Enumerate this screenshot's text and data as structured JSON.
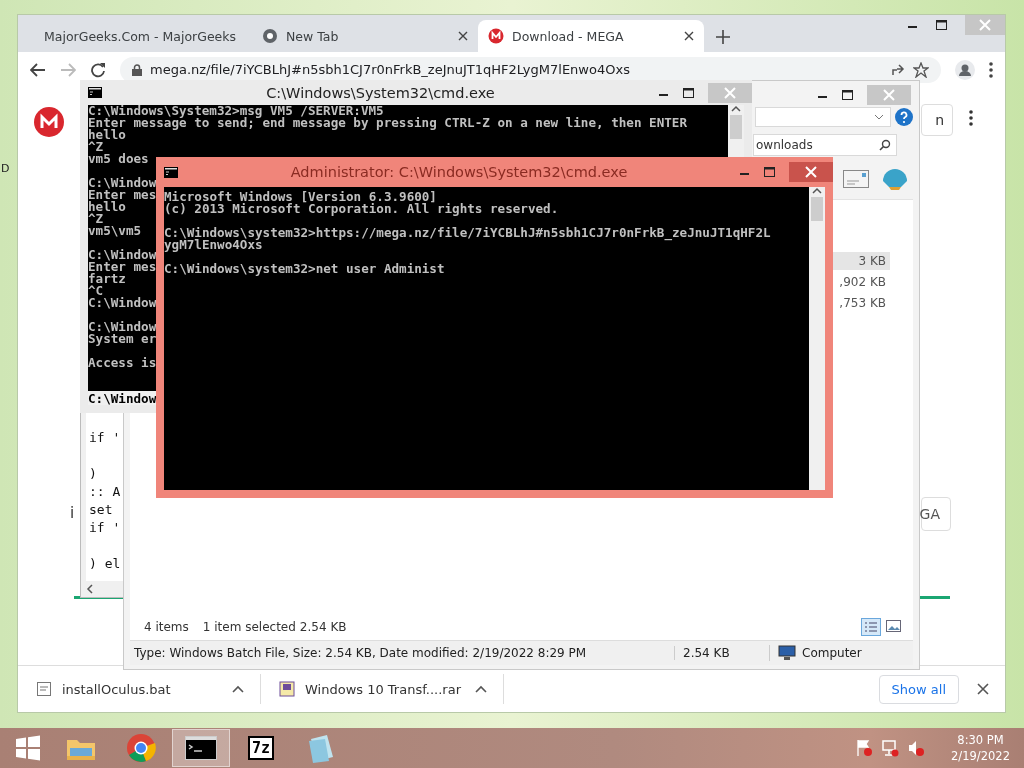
{
  "desktop": {
    "edge_label": "D"
  },
  "browser": {
    "tabs": [
      {
        "title": "MajorGeeks.Com - MajorGeeks",
        "selected": false
      },
      {
        "title": "New Tab",
        "selected": false
      },
      {
        "title": "Download - MEGA",
        "selected": true
      }
    ],
    "url": "mega.nz/file/7iYCBLhJ#n5sbh1CJ7r0nFrkB_zeJnuJT1qHF2LygM7lEnwo4Oxs",
    "page": {
      "top_button": "n",
      "side_letter": "i",
      "bottom_button": "GA",
      "progress": {
        "level": 1
      }
    },
    "downloads": [
      {
        "name": "installOculus.bat",
        "kind": "bat"
      },
      {
        "name": "Windows 10 Transf....rar",
        "kind": "rar"
      }
    ],
    "show_all": "Show all"
  },
  "notepad": {
    "lines": [
      {
        "kind": "text",
        "text": "if '"
      },
      {
        "kind": "blank"
      },
      {
        "kind": "text",
        "text": ")"
      },
      {
        "kind": "text",
        "text": ":: A"
      },
      {
        "kind": "text",
        "text": "set"
      },
      {
        "kind": "text",
        "text": "if '"
      },
      {
        "kind": "blank"
      },
      {
        "kind": "text",
        "text": ") el"
      }
    ]
  },
  "explorer": {
    "search": {
      "value": "ownloads"
    },
    "files": [
      {
        "size": "3 KB",
        "selected": true
      },
      {
        "size": ",902 KB",
        "selected": false
      },
      {
        "size": ",753 KB",
        "selected": false
      }
    ],
    "status": {
      "items": "4 items",
      "selection": "1 item selected",
      "selection_size": "2.54 KB"
    },
    "details": {
      "summary": "Type: Windows Batch File, Size: 2.54 KB, Date modified: 2/19/2022 8:29 PM",
      "size": "2.54 KB",
      "zone": "Computer"
    }
  },
  "cmd_window": {
    "title": "C:\\Windows\\System32\\cmd.exe",
    "active": false,
    "lines": [
      {
        "kind": "text",
        "text": "C:\\Windows\\System32>msg VM5 /SERVER:VM5",
        "selected": false
      },
      {
        "kind": "text",
        "text": "Enter message to send; end message by pressing CTRL-Z on a new line, then ENTER",
        "selected": false
      },
      {
        "kind": "text",
        "text": "hello",
        "selected": false
      },
      {
        "kind": "text",
        "text": "^Z",
        "selected": false
      },
      {
        "kind": "text",
        "text": "vm5 does",
        "selected": false
      },
      {
        "kind": "blank"
      },
      {
        "kind": "text",
        "text": "C:\\Window",
        "selected": false
      },
      {
        "kind": "text",
        "text": "Enter mes",
        "selected": false
      },
      {
        "kind": "text",
        "text": "hello",
        "selected": false
      },
      {
        "kind": "text",
        "text": "^Z",
        "selected": false
      },
      {
        "kind": "text",
        "text": "vm5\\vm5",
        "selected": false
      },
      {
        "kind": "blank"
      },
      {
        "kind": "text",
        "text": "C:\\Window",
        "selected": false
      },
      {
        "kind": "text",
        "text": "Enter mes",
        "selected": false
      },
      {
        "kind": "text",
        "text": "fartz",
        "selected": false
      },
      {
        "kind": "text",
        "text": "^C",
        "selected": false
      },
      {
        "kind": "text",
        "text": "C:\\Window",
        "selected": false
      },
      {
        "kind": "blank"
      },
      {
        "kind": "text",
        "text": "C:\\Window",
        "selected": false
      },
      {
        "kind": "text",
        "text": "System er",
        "selected": false
      },
      {
        "kind": "blank"
      },
      {
        "kind": "text",
        "text": "Access is",
        "selected": false
      },
      {
        "kind": "blank"
      },
      {
        "kind": "blank"
      },
      {
        "kind": "text",
        "text": "C:\\Window",
        "selected": true
      }
    ]
  },
  "admin_window": {
    "title": "Administrator: C:\\Windows\\System32\\cmd.exe",
    "active": true,
    "lines": [
      {
        "kind": "text",
        "text": "Microsoft Windows [Version 6.3.9600]"
      },
      {
        "kind": "text",
        "text": "(c) 2013 Microsoft Corporation. All rights reserved."
      },
      {
        "kind": "blank"
      },
      {
        "kind": "text",
        "text": "C:\\Windows\\system32>https://mega.nz/file/7iYCBLhJ#n5sbh1CJ7r0nFrkB_zeJnuJT1qHF2L"
      },
      {
        "kind": "text",
        "text": "ygM7lEnwo4Oxs"
      },
      {
        "kind": "blank"
      },
      {
        "kind": "text",
        "text": "C:\\Windows\\system32>net user Administ"
      }
    ]
  },
  "taskbar": {
    "apps": [
      {
        "kind": "explorer",
        "active": false
      },
      {
        "kind": "chrome",
        "active": false
      },
      {
        "kind": "cmd",
        "active": true
      },
      {
        "kind": "archiver",
        "label": "7z",
        "active": false
      },
      {
        "kind": "notepad",
        "active": false
      }
    ],
    "clock": {
      "time": "8:30 PM",
      "date": "2/19/2022"
    }
  }
}
